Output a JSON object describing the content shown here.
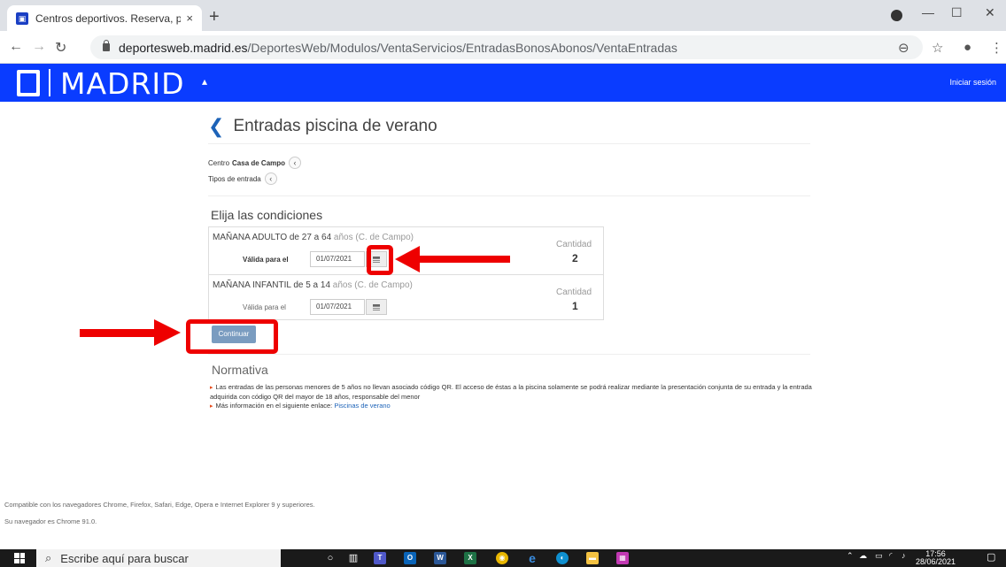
{
  "browser": {
    "tab_title": "Centros deportivos. Reserva, pag",
    "tab_close": "×",
    "new_tab": "+",
    "url_host": "deportesweb.madrid.es",
    "url_path": "/DeportesWeb/Modulos/VentaServicios/EntradasBonosAbonos/VentaEntradas",
    "window_controls": [
      "—",
      "☐",
      "✕"
    ]
  },
  "header": {
    "brand": "MADRID",
    "login_label": "Iniciar sesión",
    "brand_color": "#0a3cff"
  },
  "page": {
    "title": "Entradas piscina de verano",
    "centro_label": "Centro",
    "centro_value": "Casa de Campo",
    "tipos_label": "Tipos de entrada",
    "conditions_title": "Elija las condiciones",
    "rows": [
      {
        "desc_main": "MAÑANA ADULTO de ",
        "age_from": "27",
        "desc_mid": " a ",
        "age_to": "64",
        "desc_tail": " años (C. de Campo)",
        "valid_label": "Válida para el",
        "date": "01/07/2021",
        "cantidad_label": "Cantidad",
        "cantidad": "2"
      },
      {
        "desc_main": "MAÑANA INFANTIL de ",
        "age_from": "5",
        "desc_mid": " a ",
        "age_to": "14",
        "desc_tail": " años (C. de Campo)",
        "valid_label": "Válida para el",
        "date": "01/07/2021",
        "cantidad_label": "Cantidad",
        "cantidad": "1"
      }
    ],
    "continue_label": "Continuar",
    "normativa_title": "Normativa",
    "normativa_1": "Las entradas de las personas menores de 5 años no llevan asociado código QR. El acceso de éstas a la piscina solamente se podrá realizar mediante la presentación conjunta de su entrada y la entrada adquirida con código QR del mayor de 18 años, responsable del menor",
    "normativa_2_prefix": "Más información en el siguiente enlace: ",
    "normativa_2_link": "Piscinas de verano"
  },
  "footer": {
    "compat": "Compatible con los navegadores Chrome, Firefox, Safari, Edge, Opera e Internet Explorer 9 y superiores.",
    "browser_info": "Su navegador es Chrome 91.0."
  },
  "taskbar": {
    "search_placeholder": "Escribe aquí para buscar",
    "time": "17:56",
    "date": "28/06/2021"
  },
  "annotation_color": "#ee0000"
}
